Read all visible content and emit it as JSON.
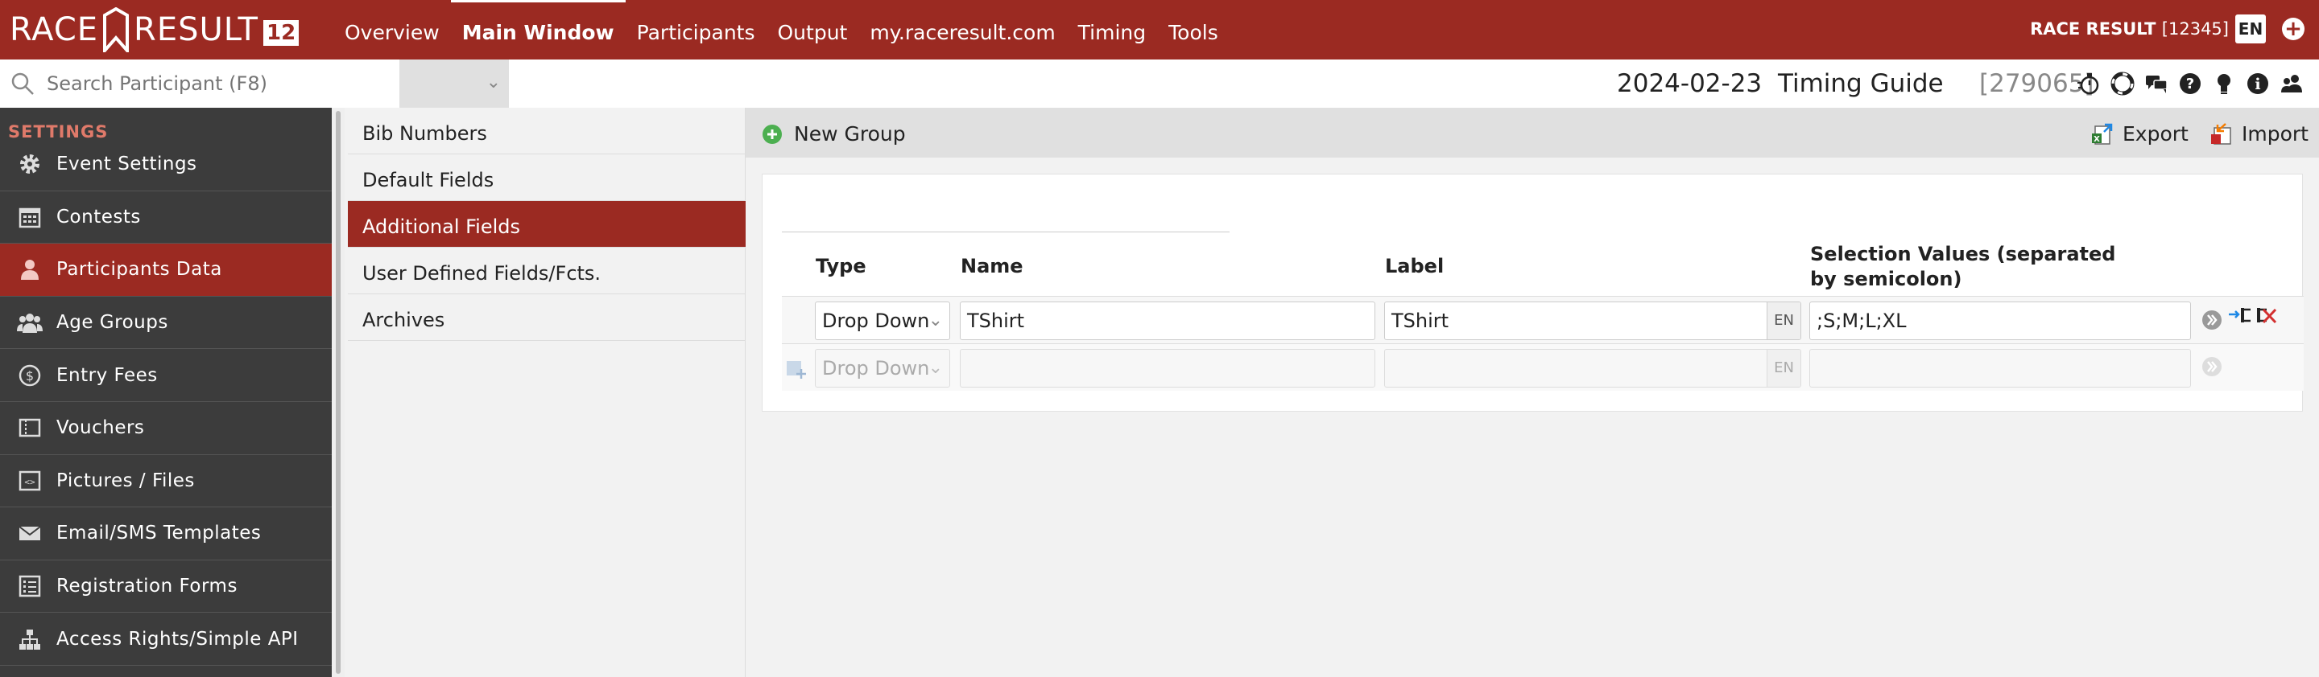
{
  "app": {
    "logo_text": "RACE RESULT",
    "version": "12",
    "nav": [
      "Overview",
      "Main Window",
      "Participants",
      "Output",
      "my.raceresult.com",
      "Timing",
      "Tools"
    ],
    "active_nav": "Main Window",
    "account_label": "RACE RESULT",
    "account_id": "[12345]",
    "language": "EN"
  },
  "search": {
    "placeholder": "Search Participant (F8)"
  },
  "event": {
    "date": "2024-02-23",
    "name": "Timing Guide",
    "id": "[279065]"
  },
  "header_icons": [
    "stopwatch-icon",
    "lifebuoy-icon",
    "chat-icon",
    "help-icon",
    "lightbulb-icon",
    "info-icon",
    "users-icon"
  ],
  "sidebar": {
    "header": "SETTINGS",
    "items": [
      {
        "label": "Event Settings",
        "icon": "gear-icon"
      },
      {
        "label": "Contests",
        "icon": "calendar-icon"
      },
      {
        "label": "Participants Data",
        "icon": "person-icon"
      },
      {
        "label": "Age Groups",
        "icon": "group-icon"
      },
      {
        "label": "Entry Fees",
        "icon": "dollar-icon"
      },
      {
        "label": "Vouchers",
        "icon": "voucher-icon"
      },
      {
        "label": "Pictures / Files",
        "icon": "file-code-icon"
      },
      {
        "label": "Email/SMS Templates",
        "icon": "envelope-icon"
      },
      {
        "label": "Registration Forms",
        "icon": "checklist-icon"
      },
      {
        "label": "Access Rights/Simple API",
        "icon": "hierarchy-icon"
      }
    ],
    "active": "Participants Data"
  },
  "submenu": {
    "items": [
      "Bib Numbers",
      "Default Fields",
      "Additional Fields",
      "User Defined Fields/Fcts.",
      "Archives"
    ],
    "active": "Additional Fields"
  },
  "toolbar": {
    "new_group": "New Group",
    "export": "Export",
    "import": "Import"
  },
  "table": {
    "group_name": "",
    "headers": {
      "type": "Type",
      "name": "Name",
      "label": "Label",
      "selection": "Selection Values (separated by semicolon)"
    },
    "rows": [
      {
        "type": "Drop Down",
        "name": "TShirt",
        "label": "TShirt",
        "lang": "EN",
        "values": ";S;M;L;XL"
      }
    ],
    "new_row": {
      "type": "Drop Down",
      "name": "",
      "label": "",
      "lang": "EN",
      "values": ""
    }
  },
  "colors": {
    "brand": "#9b2a22",
    "sidebar": "#3c3c3c",
    "accent_green": "#4caf50"
  }
}
